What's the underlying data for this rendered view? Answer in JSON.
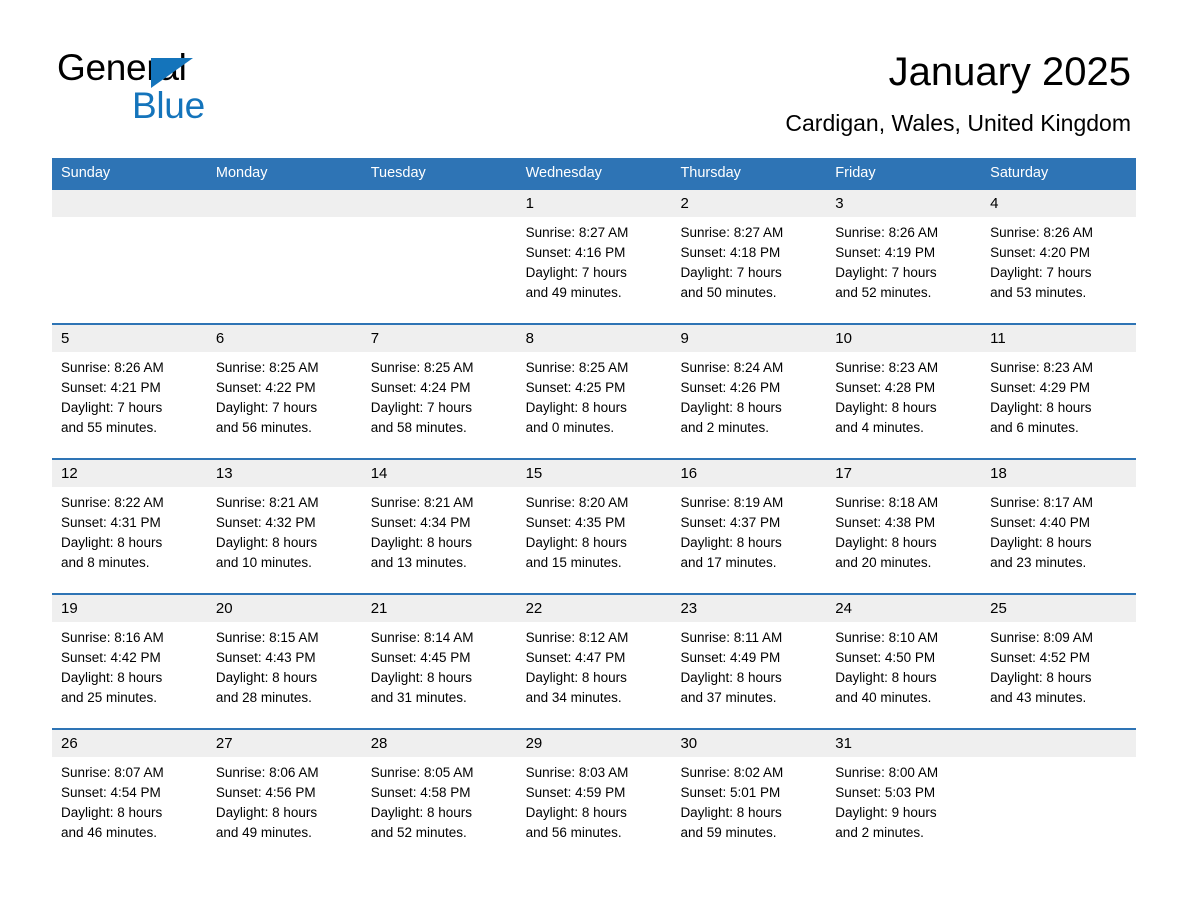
{
  "brand": {
    "word1": "General",
    "word2": "Blue",
    "triangle_color": "#1474bb"
  },
  "header": {
    "title": "January 2025",
    "subtitle": "Cardigan, Wales, United Kingdom",
    "header_bg_color": "#2e74b5",
    "row_divider_color": "#2e74b5",
    "day_band_color": "#efefef"
  },
  "weekdays": [
    "Sunday",
    "Monday",
    "Tuesday",
    "Wednesday",
    "Thursday",
    "Friday",
    "Saturday"
  ],
  "weeks": [
    [
      {
        "day": "",
        "sunrise": "",
        "sunset": "",
        "daylight1": "",
        "daylight2": "",
        "empty": true
      },
      {
        "day": "",
        "sunrise": "",
        "sunset": "",
        "daylight1": "",
        "daylight2": "",
        "empty": true
      },
      {
        "day": "",
        "sunrise": "",
        "sunset": "",
        "daylight1": "",
        "daylight2": "",
        "empty": true
      },
      {
        "day": "1",
        "sunrise": "Sunrise: 8:27 AM",
        "sunset": "Sunset: 4:16 PM",
        "daylight1": "Daylight: 7 hours",
        "daylight2": "and 49 minutes.",
        "empty": false
      },
      {
        "day": "2",
        "sunrise": "Sunrise: 8:27 AM",
        "sunset": "Sunset: 4:18 PM",
        "daylight1": "Daylight: 7 hours",
        "daylight2": "and 50 minutes.",
        "empty": false
      },
      {
        "day": "3",
        "sunrise": "Sunrise: 8:26 AM",
        "sunset": "Sunset: 4:19 PM",
        "daylight1": "Daylight: 7 hours",
        "daylight2": "and 52 minutes.",
        "empty": false
      },
      {
        "day": "4",
        "sunrise": "Sunrise: 8:26 AM",
        "sunset": "Sunset: 4:20 PM",
        "daylight1": "Daylight: 7 hours",
        "daylight2": "and 53 minutes.",
        "empty": false
      }
    ],
    [
      {
        "day": "5",
        "sunrise": "Sunrise: 8:26 AM",
        "sunset": "Sunset: 4:21 PM",
        "daylight1": "Daylight: 7 hours",
        "daylight2": "and 55 minutes.",
        "empty": false
      },
      {
        "day": "6",
        "sunrise": "Sunrise: 8:25 AM",
        "sunset": "Sunset: 4:22 PM",
        "daylight1": "Daylight: 7 hours",
        "daylight2": "and 56 minutes.",
        "empty": false
      },
      {
        "day": "7",
        "sunrise": "Sunrise: 8:25 AM",
        "sunset": "Sunset: 4:24 PM",
        "daylight1": "Daylight: 7 hours",
        "daylight2": "and 58 minutes.",
        "empty": false
      },
      {
        "day": "8",
        "sunrise": "Sunrise: 8:25 AM",
        "sunset": "Sunset: 4:25 PM",
        "daylight1": "Daylight: 8 hours",
        "daylight2": "and 0 minutes.",
        "empty": false
      },
      {
        "day": "9",
        "sunrise": "Sunrise: 8:24 AM",
        "sunset": "Sunset: 4:26 PM",
        "daylight1": "Daylight: 8 hours",
        "daylight2": "and 2 minutes.",
        "empty": false
      },
      {
        "day": "10",
        "sunrise": "Sunrise: 8:23 AM",
        "sunset": "Sunset: 4:28 PM",
        "daylight1": "Daylight: 8 hours",
        "daylight2": "and 4 minutes.",
        "empty": false
      },
      {
        "day": "11",
        "sunrise": "Sunrise: 8:23 AM",
        "sunset": "Sunset: 4:29 PM",
        "daylight1": "Daylight: 8 hours",
        "daylight2": "and 6 minutes.",
        "empty": false
      }
    ],
    [
      {
        "day": "12",
        "sunrise": "Sunrise: 8:22 AM",
        "sunset": "Sunset: 4:31 PM",
        "daylight1": "Daylight: 8 hours",
        "daylight2": "and 8 minutes.",
        "empty": false
      },
      {
        "day": "13",
        "sunrise": "Sunrise: 8:21 AM",
        "sunset": "Sunset: 4:32 PM",
        "daylight1": "Daylight: 8 hours",
        "daylight2": "and 10 minutes.",
        "empty": false
      },
      {
        "day": "14",
        "sunrise": "Sunrise: 8:21 AM",
        "sunset": "Sunset: 4:34 PM",
        "daylight1": "Daylight: 8 hours",
        "daylight2": "and 13 minutes.",
        "empty": false
      },
      {
        "day": "15",
        "sunrise": "Sunrise: 8:20 AM",
        "sunset": "Sunset: 4:35 PM",
        "daylight1": "Daylight: 8 hours",
        "daylight2": "and 15 minutes.",
        "empty": false
      },
      {
        "day": "16",
        "sunrise": "Sunrise: 8:19 AM",
        "sunset": "Sunset: 4:37 PM",
        "daylight1": "Daylight: 8 hours",
        "daylight2": "and 17 minutes.",
        "empty": false
      },
      {
        "day": "17",
        "sunrise": "Sunrise: 8:18 AM",
        "sunset": "Sunset: 4:38 PM",
        "daylight1": "Daylight: 8 hours",
        "daylight2": "and 20 minutes.",
        "empty": false
      },
      {
        "day": "18",
        "sunrise": "Sunrise: 8:17 AM",
        "sunset": "Sunset: 4:40 PM",
        "daylight1": "Daylight: 8 hours",
        "daylight2": "and 23 minutes.",
        "empty": false
      }
    ],
    [
      {
        "day": "19",
        "sunrise": "Sunrise: 8:16 AM",
        "sunset": "Sunset: 4:42 PM",
        "daylight1": "Daylight: 8 hours",
        "daylight2": "and 25 minutes.",
        "empty": false
      },
      {
        "day": "20",
        "sunrise": "Sunrise: 8:15 AM",
        "sunset": "Sunset: 4:43 PM",
        "daylight1": "Daylight: 8 hours",
        "daylight2": "and 28 minutes.",
        "empty": false
      },
      {
        "day": "21",
        "sunrise": "Sunrise: 8:14 AM",
        "sunset": "Sunset: 4:45 PM",
        "daylight1": "Daylight: 8 hours",
        "daylight2": "and 31 minutes.",
        "empty": false
      },
      {
        "day": "22",
        "sunrise": "Sunrise: 8:12 AM",
        "sunset": "Sunset: 4:47 PM",
        "daylight1": "Daylight: 8 hours",
        "daylight2": "and 34 minutes.",
        "empty": false
      },
      {
        "day": "23",
        "sunrise": "Sunrise: 8:11 AM",
        "sunset": "Sunset: 4:49 PM",
        "daylight1": "Daylight: 8 hours",
        "daylight2": "and 37 minutes.",
        "empty": false
      },
      {
        "day": "24",
        "sunrise": "Sunrise: 8:10 AM",
        "sunset": "Sunset: 4:50 PM",
        "daylight1": "Daylight: 8 hours",
        "daylight2": "and 40 minutes.",
        "empty": false
      },
      {
        "day": "25",
        "sunrise": "Sunrise: 8:09 AM",
        "sunset": "Sunset: 4:52 PM",
        "daylight1": "Daylight: 8 hours",
        "daylight2": "and 43 minutes.",
        "empty": false
      }
    ],
    [
      {
        "day": "26",
        "sunrise": "Sunrise: 8:07 AM",
        "sunset": "Sunset: 4:54 PM",
        "daylight1": "Daylight: 8 hours",
        "daylight2": "and 46 minutes.",
        "empty": false
      },
      {
        "day": "27",
        "sunrise": "Sunrise: 8:06 AM",
        "sunset": "Sunset: 4:56 PM",
        "daylight1": "Daylight: 8 hours",
        "daylight2": "and 49 minutes.",
        "empty": false
      },
      {
        "day": "28",
        "sunrise": "Sunrise: 8:05 AM",
        "sunset": "Sunset: 4:58 PM",
        "daylight1": "Daylight: 8 hours",
        "daylight2": "and 52 minutes.",
        "empty": false
      },
      {
        "day": "29",
        "sunrise": "Sunrise: 8:03 AM",
        "sunset": "Sunset: 4:59 PM",
        "daylight1": "Daylight: 8 hours",
        "daylight2": "and 56 minutes.",
        "empty": false
      },
      {
        "day": "30",
        "sunrise": "Sunrise: 8:02 AM",
        "sunset": "Sunset: 5:01 PM",
        "daylight1": "Daylight: 8 hours",
        "daylight2": "and 59 minutes.",
        "empty": false
      },
      {
        "day": "31",
        "sunrise": "Sunrise: 8:00 AM",
        "sunset": "Sunset: 5:03 PM",
        "daylight1": "Daylight: 9 hours",
        "daylight2": "and 2 minutes.",
        "empty": false
      },
      {
        "day": "",
        "sunrise": "",
        "sunset": "",
        "daylight1": "",
        "daylight2": "",
        "empty": true
      }
    ]
  ]
}
